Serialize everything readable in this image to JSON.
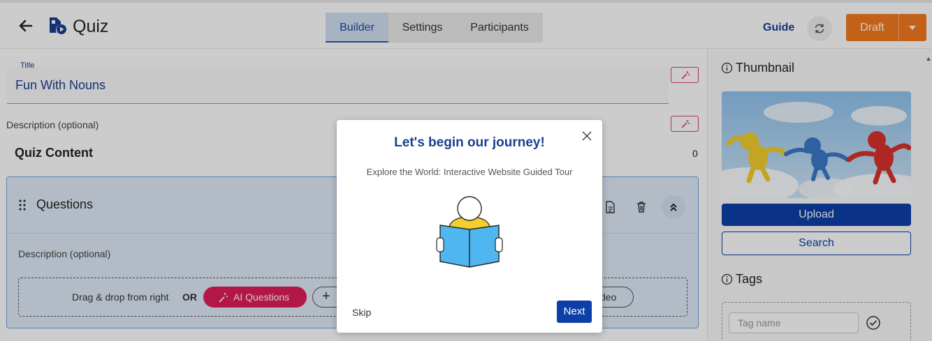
{
  "header": {
    "app_title": "Quiz",
    "tabs": [
      {
        "label": "Builder",
        "active": true
      },
      {
        "label": "Settings",
        "active": false
      },
      {
        "label": "Participants",
        "active": false
      }
    ],
    "guide_label": "Guide",
    "draft_label": "Draft",
    "accent_color": "#f47a20"
  },
  "main": {
    "title_label": "Title",
    "title_value": "Fun With Nouns",
    "description_label": "Description (optional)",
    "content_heading": "Quiz Content",
    "content_count": "0",
    "questions": {
      "title": "Questions",
      "description_label": "Description (optional)",
      "drop_text": "Drag & drop from right",
      "or_text": "OR",
      "ai_button_label": "AI Questions",
      "add_button_label": "+",
      "video_button_label": "deo"
    }
  },
  "sidebar": {
    "thumbnail_heading": "Thumbnail",
    "upload_label": "Upload",
    "search_label": "Search",
    "tags_heading": "Tags",
    "tag_placeholder": "Tag name"
  },
  "modal": {
    "title": "Let's begin our journey!",
    "subtitle": "Explore the World: Interactive Website Guided Tour",
    "skip_label": "Skip",
    "next_label": "Next"
  },
  "colors": {
    "primary": "#0d3fa8",
    "ai_pink": "#e01d5a",
    "link_blue": "#1a3f8f"
  }
}
